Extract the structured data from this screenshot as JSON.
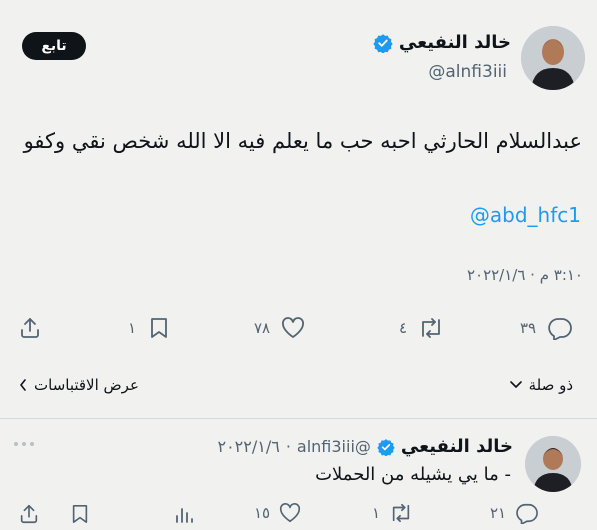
{
  "main_tweet": {
    "author_name": "خالد النفيعي",
    "handle": "@alnfi3iii",
    "follow_label": "تابع",
    "text": "عبدالسلام الحارثي احبه حب ما يعلم فيه الا الله شخص نقي وكفو",
    "mention": "@abd_hfc1",
    "timestamp": "٣:١٠ م · ٢٠٢٢/١/٦",
    "actions": {
      "replies": "٣٩",
      "retweets": "٤",
      "likes": "٧٨",
      "bookmarks": "١"
    },
    "view_quotes_label": "عرض الاقتباسات",
    "relevant_label": "ذو صلة"
  },
  "reply_tweet": {
    "author_name": "خالد النفيعي",
    "handle": "@alnfi3iii",
    "date": "٢٠٢٢/١/٦",
    "separator": "·",
    "text": "- ما يي يشيله من الحملات",
    "actions": {
      "replies": "٢١",
      "retweets": "١",
      "likes": "١٥"
    }
  },
  "colors": {
    "verified": "#1d9bf0",
    "text": "#0f1419",
    "secondary": "#536471",
    "background": "#f1f1f0"
  },
  "icons": [
    "verified-badge-icon",
    "reply-icon",
    "retweet-icon",
    "like-icon",
    "bookmark-icon",
    "share-icon",
    "views-icon",
    "chevron-down-icon",
    "chevron-left-icon",
    "more-icon"
  ]
}
